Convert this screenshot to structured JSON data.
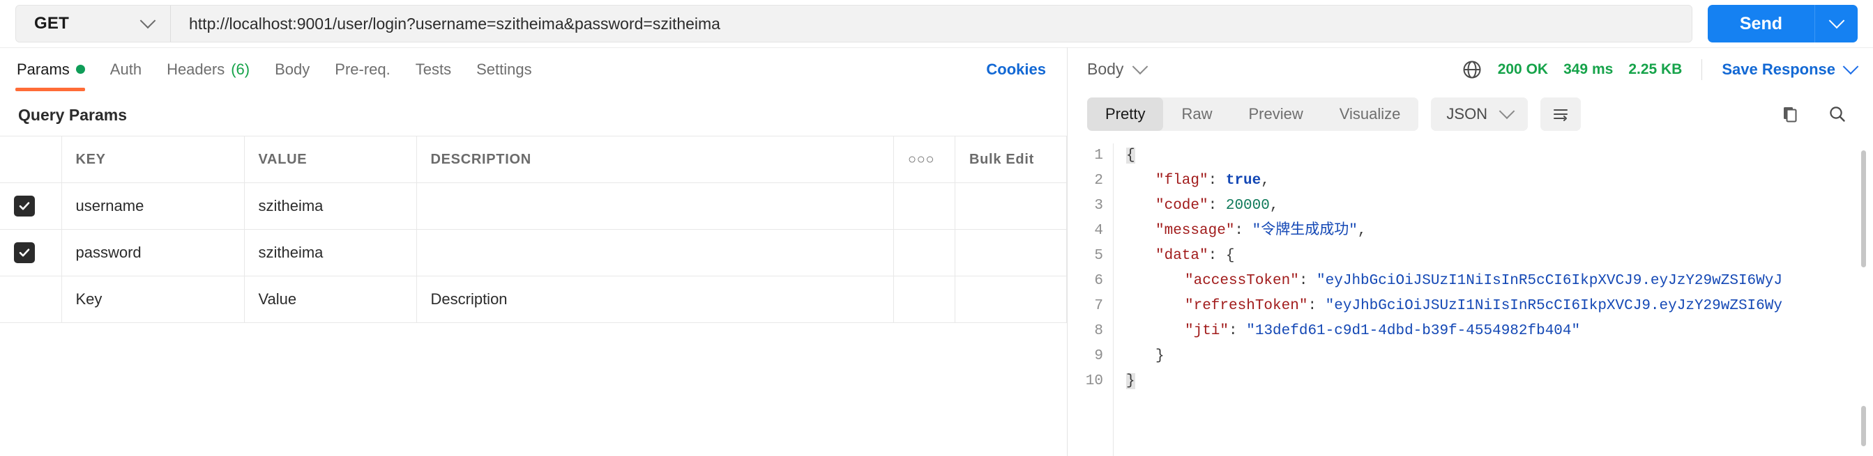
{
  "request": {
    "method": "GET",
    "url": "http://localhost:9001/user/login?username=szitheima&password=szitheima",
    "send_label": "Send"
  },
  "request_tabs": [
    {
      "label": "Params",
      "badge": "",
      "dot": true,
      "active": true
    },
    {
      "label": "Auth",
      "badge": "",
      "dot": false,
      "active": false
    },
    {
      "label": "Headers",
      "badge": "(6)",
      "dot": false,
      "active": false
    },
    {
      "label": "Body",
      "badge": "",
      "dot": false,
      "active": false
    },
    {
      "label": "Pre-req.",
      "badge": "",
      "dot": false,
      "active": false
    },
    {
      "label": "Tests",
      "badge": "",
      "dot": false,
      "active": false
    },
    {
      "label": "Settings",
      "badge": "",
      "dot": false,
      "active": false
    }
  ],
  "cookies_label": "Cookies",
  "params": {
    "section_title": "Query Params",
    "columns": [
      "KEY",
      "VALUE",
      "DESCRIPTION"
    ],
    "more_label": "○○○",
    "bulk_edit_label": "Bulk Edit",
    "rows": [
      {
        "checked": true,
        "key": "username",
        "value": "szitheima",
        "description": ""
      },
      {
        "checked": true,
        "key": "password",
        "value": "szitheima",
        "description": ""
      }
    ],
    "placeholder_row": {
      "key": "Key",
      "value": "Value",
      "description": "Description"
    }
  },
  "response": {
    "body_select_label": "Body",
    "status": "200 OK",
    "time": "349 ms",
    "size": "2.25 KB",
    "save_label": "Save Response",
    "view_tabs": [
      {
        "label": "Pretty",
        "active": true
      },
      {
        "label": "Raw",
        "active": false
      },
      {
        "label": "Preview",
        "active": false
      },
      {
        "label": "Visualize",
        "active": false
      }
    ],
    "format": "JSON",
    "line_numbers": [
      "1",
      "2",
      "3",
      "4",
      "5",
      "6",
      "7",
      "8",
      "9",
      "10"
    ],
    "json": {
      "flag": "true",
      "code": "20000",
      "message": "令牌生成成功",
      "data": {
        "accessToken": "eyJhbGciOiJSUzI1NiIsInR5cCI6IkpXVCJ9.eyJzY29wZSI6WyJ",
        "refreshToken": "eyJhbGciOiJSUzI1NiIsInR5cCI6IkpXVCJ9.eyJzY29wZSI6Wy",
        "jti": "13defd61-c9d1-4dbd-b39f-4554982fb404"
      }
    },
    "tokens": {
      "k_flag": "\"flag\"",
      "k_code": "\"code\"",
      "k_message": "\"message\"",
      "k_data": "\"data\"",
      "k_access": "\"accessToken\"",
      "k_refresh": "\"refreshToken\"",
      "k_jti": "\"jti\"",
      "v_flag": "true",
      "v_code": "20000",
      "v_message": "\"令牌生成成功\"",
      "v_access": "\"eyJhbGciOiJSUzI1NiIsInR5cCI6IkpXVCJ9.eyJzY29wZSI6WyJ",
      "v_refresh": "\"eyJhbGciOiJSUzI1NiIsInR5cCI6IkpXVCJ9.eyJzY29wZSI6Wy",
      "v_jti": "\"13defd61-c9d1-4dbd-b39f-4554982fb404\"",
      "brace_open": "{",
      "brace_close": "}",
      "brace_close_inner": "}",
      "colon": ":",
      "comma": ","
    }
  },
  "colors": {
    "accent_orange": "#ff6c37",
    "send_blue": "#1581f2",
    "link_blue": "#1268d4",
    "status_green": "#16a34a",
    "json_key": "#a11b1b",
    "json_string": "#1448b5",
    "json_number": "#0f7a5a"
  }
}
